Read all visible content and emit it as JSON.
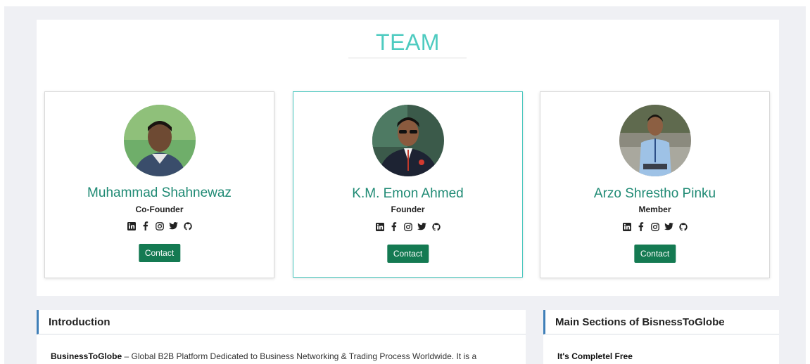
{
  "team": {
    "title": "TEAM",
    "members": [
      {
        "name": "Muhammad Shahnewaz",
        "role": "Co-Founder",
        "contact_label": "Contact"
      },
      {
        "name": "K.M. Emon Ahmed",
        "role": "Founder",
        "contact_label": "Contact"
      },
      {
        "name": "Arzo Shrestho Pinku",
        "role": "Member",
        "contact_label": "Contact"
      }
    ]
  },
  "intro": {
    "heading": "Introduction",
    "brand": "BusinessToGlobe",
    "text": " – Global B2B Platform Dedicated to Business Networking & Trading Process Worldwide. It is a"
  },
  "main_sections": {
    "heading": "Main Sections of BisnessToGlobe",
    "first_item": "It's Completel Free"
  },
  "colors": {
    "title": "#4ecbc0",
    "name": "#1f8a74",
    "button": "#147a52",
    "active_border": "#45c6bd",
    "section_accent": "#3f7fb8"
  },
  "icons": [
    "linkedin-icon",
    "facebook-icon",
    "instagram-icon",
    "twitter-icon",
    "github-icon"
  ]
}
